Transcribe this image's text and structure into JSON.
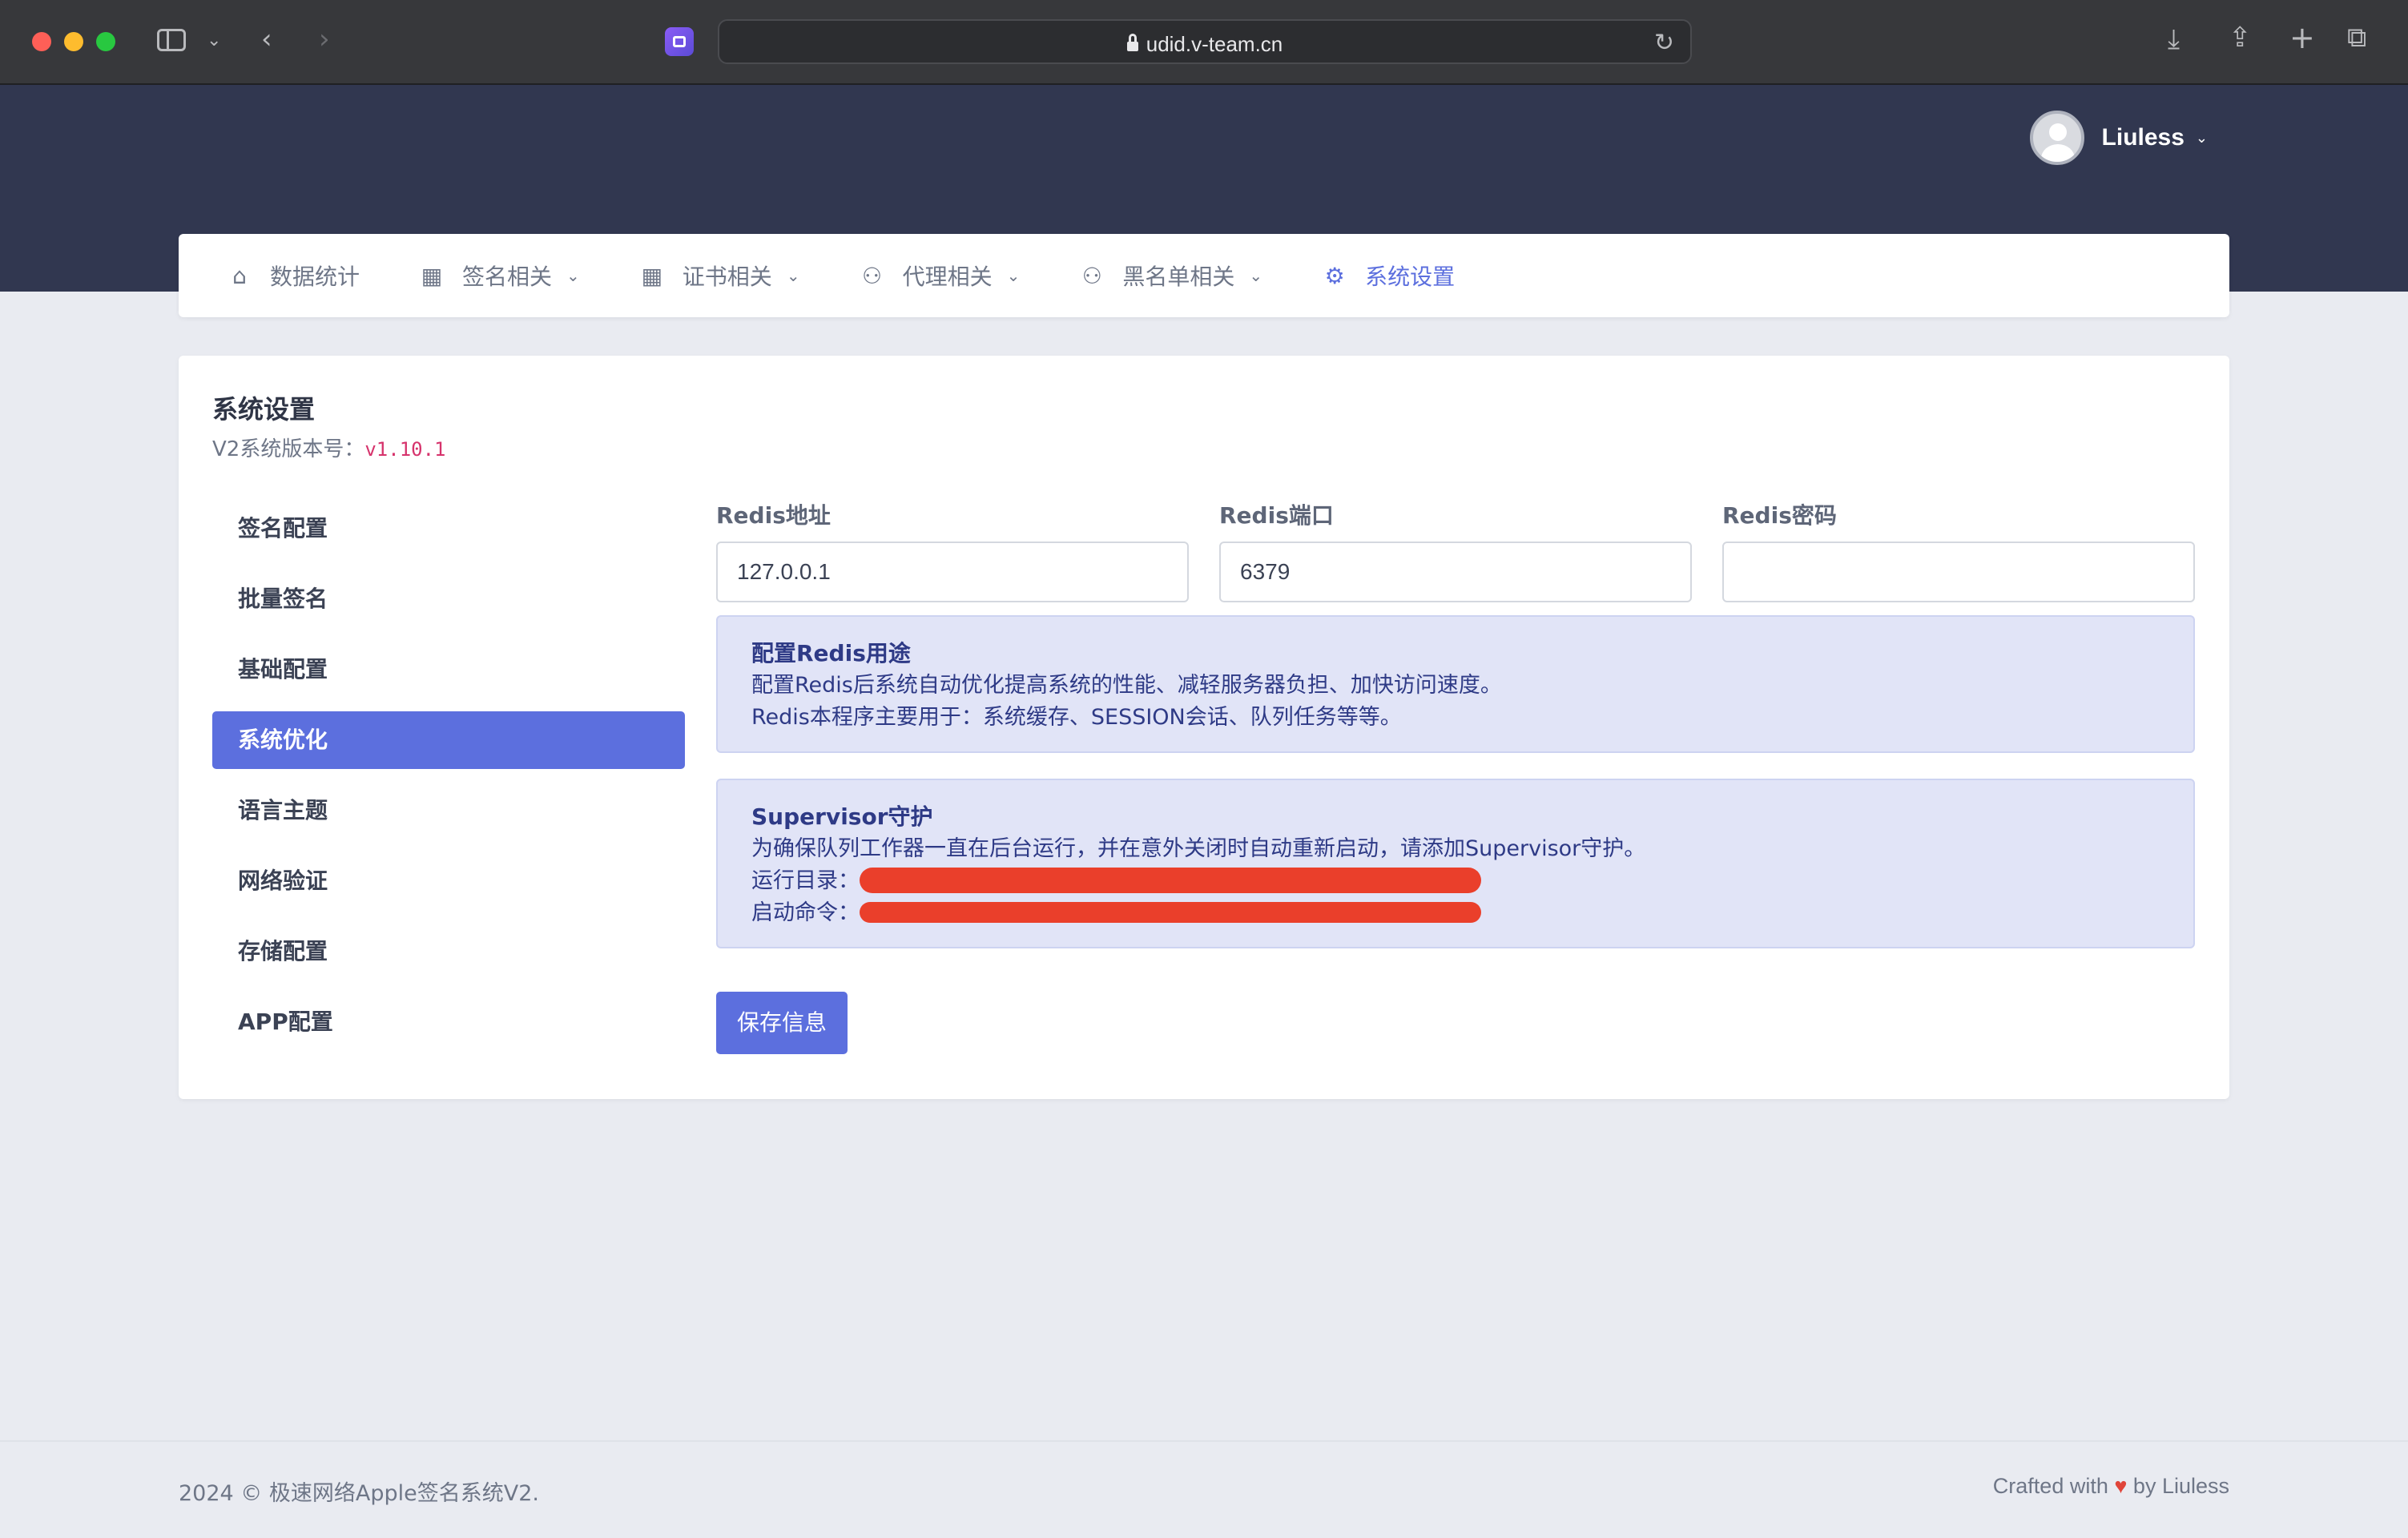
{
  "browser": {
    "url": "udid.v-team.cn"
  },
  "header": {
    "user_name": "Liuless"
  },
  "nav": {
    "items": [
      {
        "label": "数据统计",
        "icon": "home-icon"
      },
      {
        "label": "签名相关",
        "icon": "grid-icon"
      },
      {
        "label": "证书相关",
        "icon": "grid-icon"
      },
      {
        "label": "代理相关",
        "icon": "users-icon"
      },
      {
        "label": "黑名单相关",
        "icon": "users-icon"
      },
      {
        "label": "系统设置",
        "icon": "gear-icon"
      }
    ],
    "active": "系统设置"
  },
  "page": {
    "title": "系统设置",
    "version_label": "V2系统版本号：",
    "version": "v1.10.1"
  },
  "side_menu": {
    "items": [
      "签名配置",
      "批量签名",
      "基础配置",
      "系统优化",
      "语言主题",
      "网络验证",
      "存储配置",
      "APP配置"
    ],
    "active": "系统优化"
  },
  "form": {
    "redis_host_label": "Redis地址",
    "redis_host_value": "127.0.0.1",
    "redis_port_label": "Redis端口",
    "redis_port_value": "6379",
    "redis_password_label": "Redis密码",
    "redis_password_value": ""
  },
  "redis_info": {
    "title": "配置Redis用途",
    "line1": "配置Redis后系统自动优化提高系统的性能、减轻服务器负担、加快访问速度。",
    "line2": "Redis本程序主要用于：系统缓存、SESSION会话、队列任务等等。"
  },
  "supervisor_info": {
    "title": "Supervisor守护",
    "line1": "为确保队列工作器一直在后台运行，并在意外关闭时自动重新启动，请添加Supervisor守护。",
    "run_dir_label": "运行目录：",
    "start_cmd_label": "启动命令："
  },
  "actions": {
    "save_label": "保存信息"
  },
  "footer": {
    "copyright": "2024 © 极速网络Apple签名系统V2.",
    "crafted_prefix": "Crafted with",
    "crafted_suffix": "by Liuless"
  },
  "colors": {
    "header_bg": "#313750",
    "accent": "#5c6fde",
    "page_bg": "#e9ebf1",
    "info_bg": "#e1e4f7",
    "redaction": "#ea3f2b"
  }
}
